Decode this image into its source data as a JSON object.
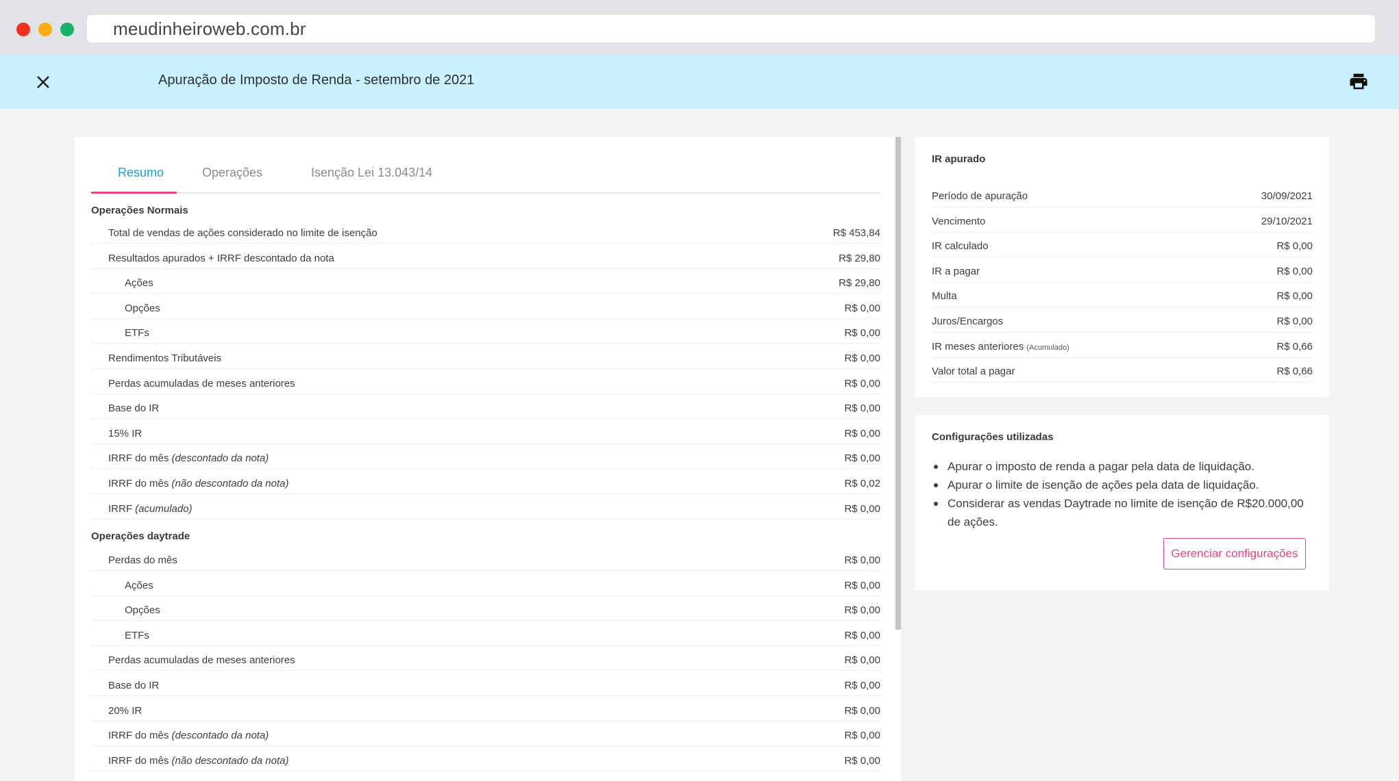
{
  "browser": {
    "url": "meudinheiroweb.com.br"
  },
  "header": {
    "title": "Apuração de Imposto de Renda - setembro de 2021",
    "close_icon": "close-icon",
    "print_icon": "printer-icon"
  },
  "tabs": [
    {
      "label": "Resumo",
      "active": true
    },
    {
      "label": "Operações",
      "active": false
    },
    {
      "label": "Isenção Lei 13.043/14",
      "active": false
    }
  ],
  "summary": {
    "normal_title": "Operações Normais",
    "normal_rows": [
      {
        "label": "Total de vendas de ações considerado no limite de isenção",
        "note": "",
        "value": "R$ 453,84",
        "level": 1
      },
      {
        "label": "Resultados apurados + IRRF descontado da nota",
        "note": "",
        "value": "R$ 29,80",
        "level": 1
      },
      {
        "label": "Ações",
        "note": "",
        "value": "R$ 29,80",
        "level": 2
      },
      {
        "label": "Opções",
        "note": "",
        "value": "R$ 0,00",
        "level": 2
      },
      {
        "label": "ETFs",
        "note": "",
        "value": "R$ 0,00",
        "level": 2
      },
      {
        "label": "Rendimentos Tributáveis",
        "note": "",
        "value": "R$ 0,00",
        "level": 1
      },
      {
        "label": "Perdas acumuladas de meses anteriores",
        "note": "",
        "value": "R$ 0,00",
        "level": 1
      },
      {
        "label": "Base do IR",
        "note": "",
        "value": "R$ 0,00",
        "level": 1
      },
      {
        "label": "15% IR",
        "note": "",
        "value": "R$ 0,00",
        "level": 1
      },
      {
        "label": "IRRF do mês ",
        "note": "(descontado da nota)",
        "value": "R$ 0,00",
        "level": 1
      },
      {
        "label": "IRRF do mês ",
        "note": "(não descontado da nota)",
        "value": "R$ 0,02",
        "level": 1
      },
      {
        "label": "IRRF ",
        "note": "(acumulado)",
        "value": "R$ 0,00",
        "level": 1
      }
    ],
    "daytrade_title": "Operações daytrade",
    "daytrade_rows": [
      {
        "label": "Perdas do mês",
        "note": "",
        "value": "R$ 0,00",
        "level": 1
      },
      {
        "label": "Ações",
        "note": "",
        "value": "R$ 0,00",
        "level": 2
      },
      {
        "label": "Opções",
        "note": "",
        "value": "R$ 0,00",
        "level": 2
      },
      {
        "label": "ETFs",
        "note": "",
        "value": "R$ 0,00",
        "level": 2
      },
      {
        "label": "Perdas acumuladas de meses anteriores",
        "note": "",
        "value": "R$ 0,00",
        "level": 1
      },
      {
        "label": "Base do IR",
        "note": "",
        "value": "R$ 0,00",
        "level": 1
      },
      {
        "label": "20% IR",
        "note": "",
        "value": "R$ 0,00",
        "level": 1
      },
      {
        "label": "IRRF do mês ",
        "note": "(descontado da nota)",
        "value": "R$ 0,00",
        "level": 1
      },
      {
        "label": "IRRF do mês ",
        "note": "(não descontado da nota)",
        "value": "R$ 0,00",
        "level": 1
      }
    ]
  },
  "ir_apurado": {
    "title": "IR apurado",
    "rows": [
      {
        "label": "Período de apuração",
        "small": "",
        "value": "30/09/2021"
      },
      {
        "label": "Vencimento",
        "small": "",
        "value": "29/10/2021"
      },
      {
        "label": "IR calculado",
        "small": "",
        "value": "R$ 0,00"
      },
      {
        "label": "IR a pagar",
        "small": "",
        "value": "R$ 0,00"
      },
      {
        "label": "Multa",
        "small": "",
        "value": "R$ 0,00"
      },
      {
        "label": "Juros/Encargos",
        "small": "",
        "value": "R$ 0,00"
      },
      {
        "label": "IR meses anteriores ",
        "small": "(Acumulado)",
        "value": "R$ 0,66"
      },
      {
        "label": "Valor total a pagar",
        "small": "",
        "value": "R$ 0,66"
      }
    ]
  },
  "config": {
    "title": "Configurações utilizadas",
    "items": [
      "Apurar o imposto de renda a pagar pela data de liquidação.",
      "Apurar o limite de isenção de ações pela data de liquidação.",
      "Considerar as vendas Daytrade no limite de isenção de R$20.000,00 de ações."
    ],
    "button_label": "Gerenciar configurações"
  },
  "colors": {
    "header_bg": "#c9f1fd",
    "tab_active": "#1a9fd8",
    "accent_pink": "#e8457d"
  }
}
